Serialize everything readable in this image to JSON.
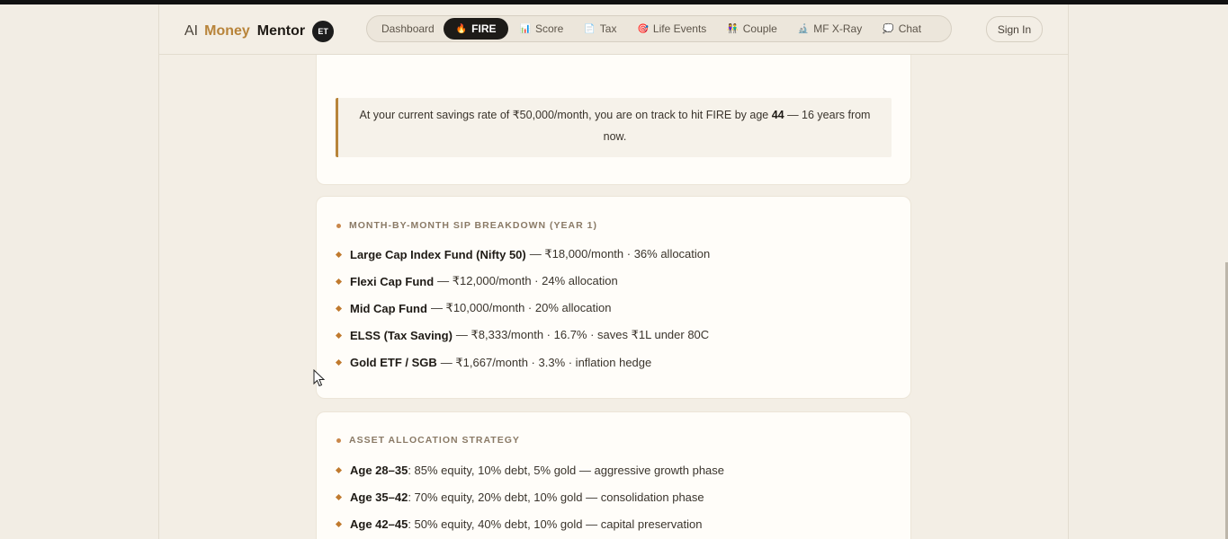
{
  "brand": {
    "ai": "AI",
    "money": "Money",
    "mentor": "Mentor",
    "badge": "ET"
  },
  "nav": {
    "tabs": [
      {
        "label": "Dashboard",
        "icon": ""
      },
      {
        "label": "FIRE",
        "icon": "🔥"
      },
      {
        "label": "Score",
        "icon": "📊"
      },
      {
        "label": "Tax",
        "icon": "📄"
      },
      {
        "label": "Life Events",
        "icon": "🎯"
      },
      {
        "label": "Couple",
        "icon": "👫"
      },
      {
        "label": "MF X-Ray",
        "icon": "🔬"
      },
      {
        "label": "Chat",
        "icon": "💭"
      }
    ],
    "active": "FIRE",
    "signin": "Sign In"
  },
  "callout": {
    "pre": "At your current savings rate of ₹50,000/month, you are on track to hit FIRE by age ",
    "age": "44",
    "post": " — 16 years from now."
  },
  "sip": {
    "title": "MONTH-BY-MONTH SIP BREAKDOWN (YEAR 1)",
    "items": [
      {
        "name": "Large Cap Index Fund (Nifty 50)",
        "detail": "— ₹18,000/month · 36% allocation"
      },
      {
        "name": "Flexi Cap Fund",
        "detail": "— ₹12,000/month · 24% allocation"
      },
      {
        "name": "Mid Cap Fund",
        "detail": "— ₹10,000/month · 20% allocation"
      },
      {
        "name": "ELSS (Tax Saving)",
        "detail": "— ₹8,333/month · 16.7% · saves ₹1L under 80C"
      },
      {
        "name": "Gold ETF / SGB",
        "detail": "— ₹1,667/month · 3.3% · inflation hedge"
      }
    ]
  },
  "allocation": {
    "title": "ASSET ALLOCATION STRATEGY",
    "items": [
      {
        "name": "Age 28–35",
        "detail": ": 85% equity, 10% debt, 5% gold — aggressive growth phase"
      },
      {
        "name": "Age 35–42",
        "detail": ": 70% equity, 20% debt, 10% gold — consolidation phase"
      },
      {
        "name": "Age 42–45",
        "detail": ": 50% equity, 40% debt, 10% gold — capital preservation"
      }
    ]
  },
  "colors": {
    "accent": "#b8843a",
    "bullet": "#c07a2e",
    "background": "#f2ede4",
    "active_tab": "#1d1b18"
  }
}
